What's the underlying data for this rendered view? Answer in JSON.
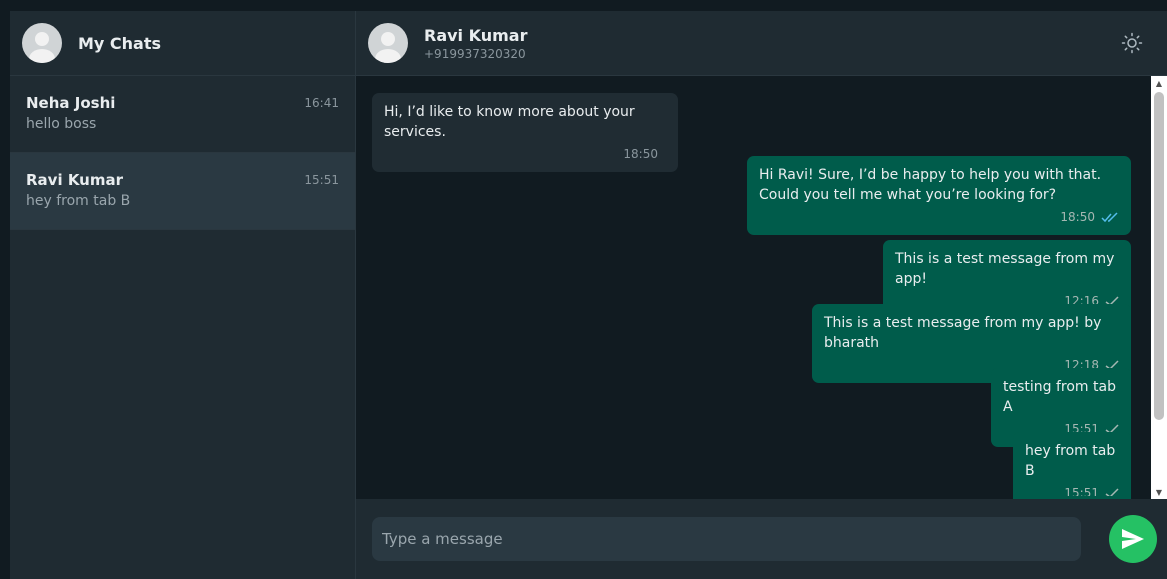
{
  "sidebar": {
    "title": "My Chats",
    "chats": [
      {
        "name": "Neha Joshi",
        "preview": "hello boss",
        "time": "16:41"
      },
      {
        "name": "Ravi Kumar",
        "preview": "hey from tab B",
        "time": "15:51"
      }
    ]
  },
  "conversation": {
    "contact_name": "Ravi Kumar",
    "contact_phone": "+919937320320",
    "theme_icon": "sun-icon",
    "messages": [
      {
        "direction": "in",
        "text": "Hi, I’d like to know more about your services.",
        "time": "18:50",
        "status": ""
      },
      {
        "direction": "out",
        "text": "Hi Ravi! Sure, I’d be happy to help you with that. Could you tell me what you’re looking for?",
        "time": "18:50",
        "status": "read"
      },
      {
        "direction": "out",
        "text": "This is a test message from my app!",
        "time": "12:16",
        "status": "sent"
      },
      {
        "direction": "out",
        "text": "This is a test message from my app! by bharath",
        "time": "12:18",
        "status": "sent"
      },
      {
        "direction": "out",
        "text": "testing from tab A",
        "time": "15:51",
        "status": "sent"
      },
      {
        "direction": "out",
        "text": "hey from tab B",
        "time": "15:51",
        "status": "sent"
      }
    ]
  },
  "composer": {
    "placeholder": "Type a message",
    "send_icon": "send-icon"
  },
  "colors": {
    "outgoing_bubble": "#005c4b",
    "incoming_bubble": "#202c33",
    "read_tick": "#53bdeb",
    "send_button": "#25c164"
  }
}
